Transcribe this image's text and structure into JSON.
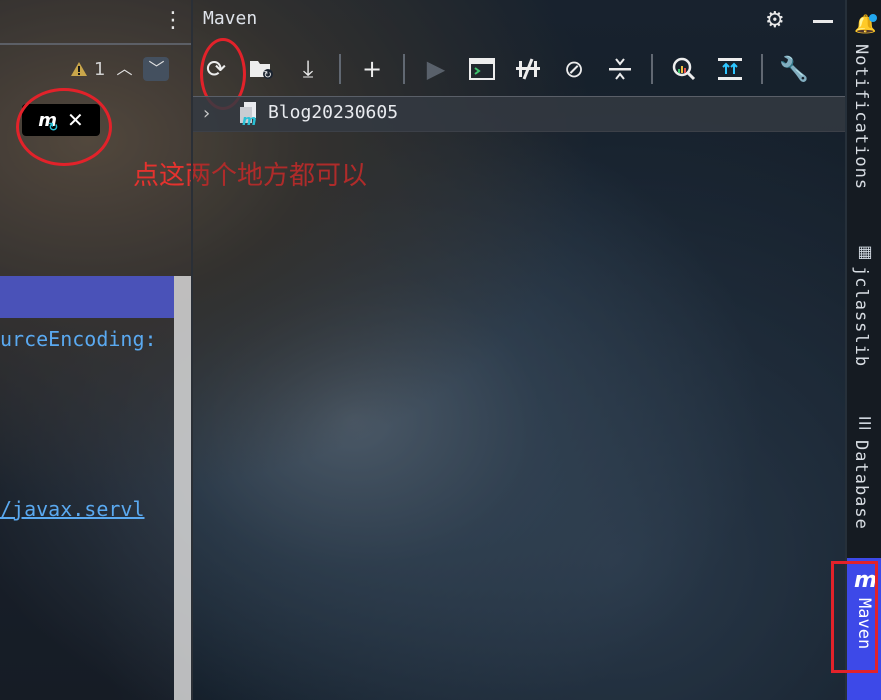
{
  "editor": {
    "inspection_count": "1",
    "code_line_1": "urceEncoding:",
    "code_line_2": "/javax.servl"
  },
  "annotation": {
    "text": "点这两个地方都可以"
  },
  "maven_panel": {
    "title": "Maven",
    "project_name": "Blog20230605"
  },
  "right_stripe": {
    "notifications": "Notifications",
    "jclasslib": "jclasslib",
    "database": "Database",
    "maven": "Maven"
  },
  "colors": {
    "annotation_red": "#e2222a",
    "maven_tab_blue": "#3d49e8"
  }
}
